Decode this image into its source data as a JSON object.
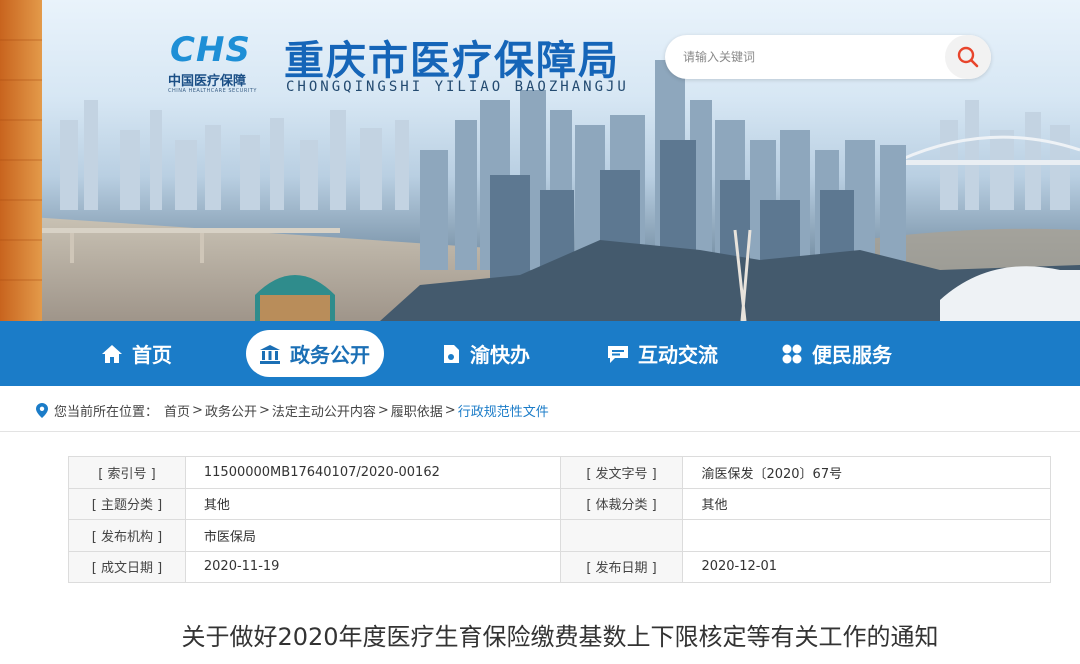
{
  "header": {
    "logo_mark": "CHS",
    "logo_cn": "中国医疗保障",
    "logo_en": "CHINA HEALTHCARE SECURITY",
    "title": "重庆市医疗保障局",
    "pinyin": "CHONGQINGSHI  YILIAO  BAOZHANGJU",
    "search_placeholder": "请输入关键词"
  },
  "nav": [
    {
      "label": "首页",
      "icon": "home-icon",
      "active": false
    },
    {
      "label": "政务公开",
      "icon": "government-icon",
      "active": true
    },
    {
      "label": "渝快办",
      "icon": "document-icon",
      "active": false
    },
    {
      "label": "互动交流",
      "icon": "chat-icon",
      "active": false
    },
    {
      "label": "便民服务",
      "icon": "grid-icon",
      "active": false
    }
  ],
  "breadcrumb": {
    "prefix": "您当前所在位置：",
    "items": [
      "首页",
      "政务公开",
      "法定主动公开内容",
      "履职依据"
    ],
    "current": "行政规范性文件",
    "separator": ">"
  },
  "meta": {
    "index_key": "[ 索引号 ]",
    "index_val": "11500000MB17640107/2020-00162",
    "docno_key": "[ 发文字号 ]",
    "docno_val": "渝医保发〔2020〕67号",
    "topic_key": "[ 主题分类 ]",
    "topic_val": "其他",
    "genre_key": "[ 体裁分类 ]",
    "genre_val": "其他",
    "org_key": "[ 发布机构 ]",
    "org_val": "市医保局",
    "created_key": "[ 成文日期 ]",
    "created_val": "2020-11-19",
    "published_key": "[ 发布日期 ]",
    "published_val": "2020-12-01"
  },
  "document": {
    "title": "关于做好2020年度医疗生育保险缴费基数上下限核定等有关工作的通知"
  },
  "colors": {
    "nav_bg": "#1b7cc8",
    "title_blue": "#1565b8",
    "crumb_current": "#1b7cc8"
  }
}
